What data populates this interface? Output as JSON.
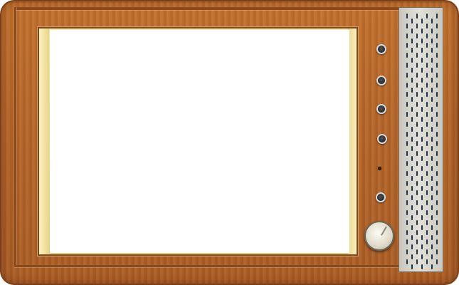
{
  "device": {
    "type": "retro-tv",
    "cabinet_color": "#b3652a",
    "bezel_color": "#e5cf7f",
    "screen_color": "#ffffff",
    "speaker_color": "#d8d7cf"
  },
  "controls": {
    "small_knobs": [
      "knob-1",
      "knob-2",
      "knob-3",
      "knob-4",
      "knob-5"
    ],
    "indicator": "indicator-light",
    "dial": "channel-dial"
  },
  "speaker": {
    "columns": 7,
    "rows": 26
  }
}
